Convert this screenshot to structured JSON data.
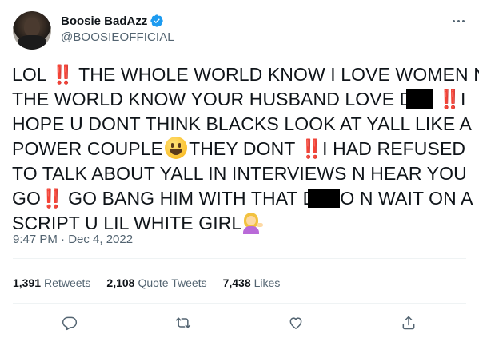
{
  "author": {
    "display_name": "Boosie BadAzz",
    "handle": "@BOOSIEOFFICIAL"
  },
  "tweet": {
    "lines": [
      [
        "LOL ",
        "‼️",
        " THE WHOLE WORLD KNOW I LOVE WOMEN N"
      ],
      [
        "THE WORLD KNOW YOUR HUSBAND LOVE D",
        "",
        "‼️",
        "I"
      ],
      [
        "HOPE U DONT THINK BLACKS LOOK AT YALL LIKE A"
      ],
      [
        "POWER COUPLE",
        "😀",
        "THEY DONT ",
        "‼️",
        "I HAD REFUSED"
      ],
      [
        "TO TALK ABOUT YALL IN INTERVIEWS N HEAR YOU"
      ],
      [
        "GO",
        "‼️",
        " GO BANG HIM WITH THAT D",
        "",
        "O N WAIT ON A"
      ],
      [
        "SCRIPT U LIL WHITE GIRL",
        "💁‍♀️"
      ]
    ],
    "timestamp": "9:47 PM · Dec 4, 2022"
  },
  "stats": {
    "retweets_count": "1,391",
    "retweets_label": "Retweets",
    "quotes_count": "2,108",
    "quotes_label": "Quote Tweets",
    "likes_count": "7,438",
    "likes_label": "Likes"
  },
  "icons": {
    "verified": "verified-badge-icon",
    "more": "more-options-icon",
    "reply": "reply-icon",
    "retweet": "retweet-icon",
    "like": "like-icon",
    "share": "share-icon"
  },
  "colors": {
    "verified_blue": "#1d9bf0",
    "text_primary": "#0f1419",
    "text_secondary": "#536471",
    "bang_red": "#d81e3c"
  }
}
